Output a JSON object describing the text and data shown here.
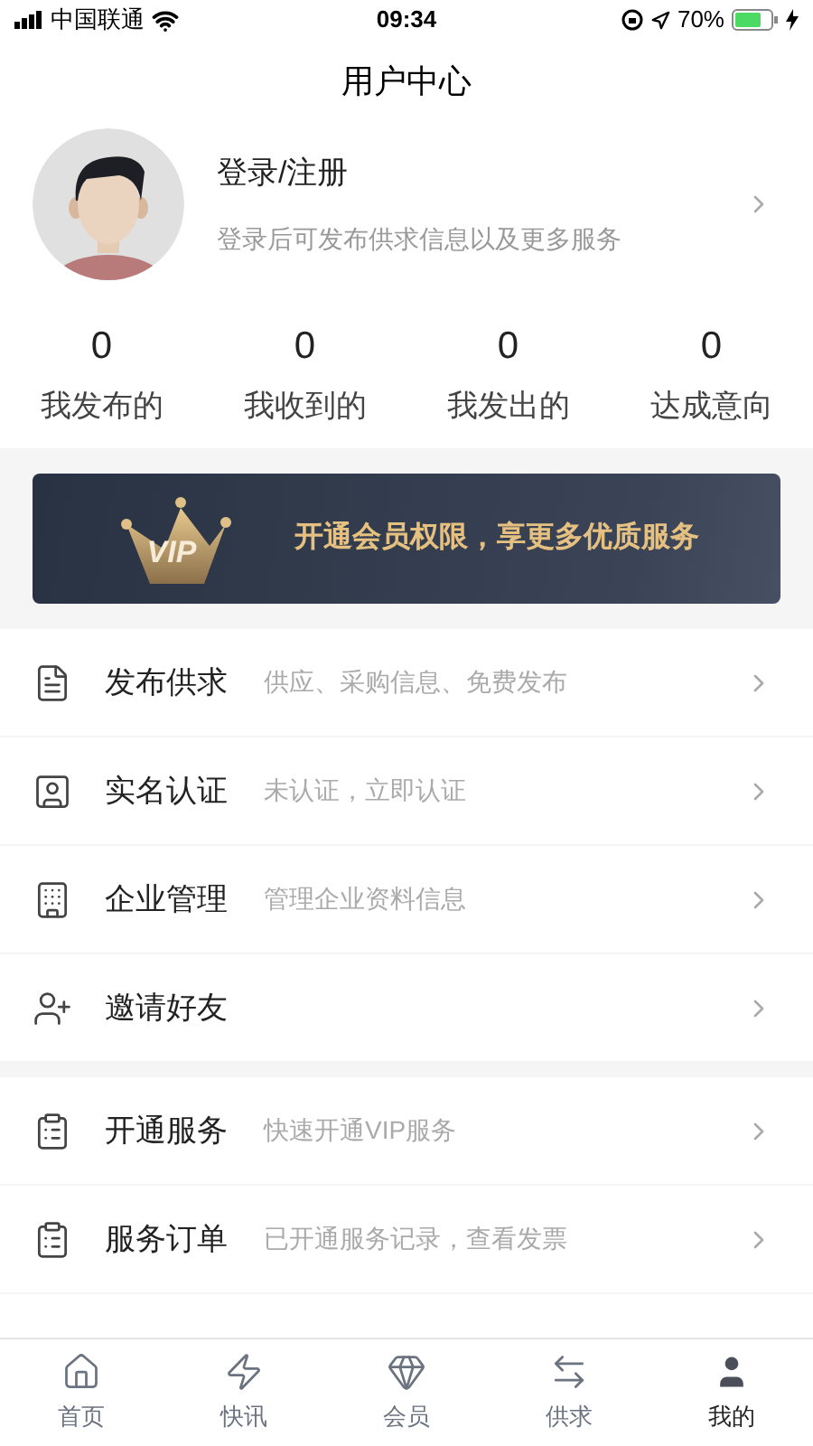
{
  "status_bar": {
    "carrier": "中国联通",
    "time": "09:34",
    "battery": "70%"
  },
  "title": "用户中心",
  "profile": {
    "name": "登录/注册",
    "hint": "登录后可发布供求信息以及更多服务"
  },
  "stats": [
    {
      "value": "0",
      "label": "我发布的"
    },
    {
      "value": "0",
      "label": "我收到的"
    },
    {
      "value": "0",
      "label": "我发出的"
    },
    {
      "value": "0",
      "label": "达成意向"
    }
  ],
  "vip_banner": {
    "logo_text": "VIP",
    "text": "开通会员权限，享更多优质服务"
  },
  "menu_groups": [
    [
      {
        "title": "发布供求",
        "subtitle": "供应、采购信息、免费发布"
      },
      {
        "title": "实名认证",
        "subtitle": "未认证，立即认证"
      },
      {
        "title": "企业管理",
        "subtitle": "管理企业资料信息"
      },
      {
        "title": "邀请好友"
      }
    ],
    [
      {
        "title": "开通服务",
        "subtitle": "快速开通VIP服务"
      },
      {
        "title": "服务订单",
        "subtitle": "已开通服务记录，查看发票"
      }
    ]
  ],
  "tabs": [
    {
      "label": "首页",
      "selected": false
    },
    {
      "label": "快讯",
      "selected": false
    },
    {
      "label": "会员",
      "selected": false
    },
    {
      "label": "供求",
      "selected": false
    },
    {
      "label": "我的",
      "selected": true
    }
  ]
}
